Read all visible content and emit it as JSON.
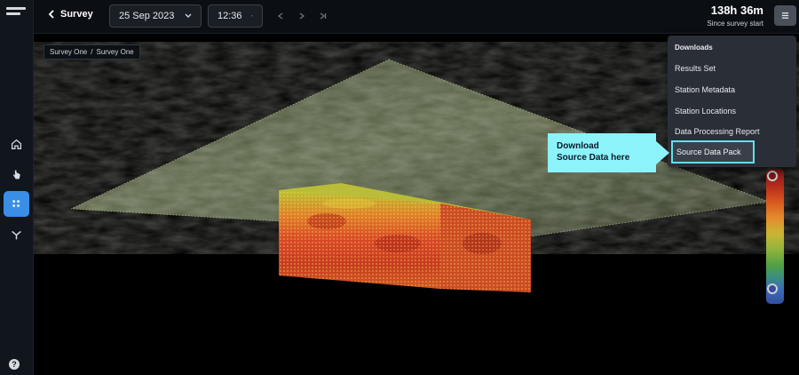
{
  "header": {
    "back_label": "Survey",
    "date_value": "25 Sep 2023",
    "time_value": "12:36",
    "elapsed_value": "138h 36m",
    "elapsed_caption": "Since survey start"
  },
  "breadcrumb": {
    "items": [
      "Survey One",
      "Survey One"
    ],
    "separator": "/"
  },
  "downloads": {
    "header": "Downloads",
    "items": [
      "Results Set",
      "Station Metadata",
      "Station Locations",
      "Data Processing Report",
      "Source Data Pack"
    ],
    "selected_index": 4
  },
  "callout": {
    "line1": "Download",
    "line2": "Source Data here"
  },
  "help": {
    "label": "?"
  },
  "colors": {
    "accent": "#3a8ee6",
    "callout": "#8cf3fb",
    "highlight_border": "#5fe0f0"
  },
  "icons": {
    "logo": "brand-logo-icon",
    "home": "home-icon",
    "hand": "hand-pointer-icon",
    "grid": "grid-icon",
    "antenna": "antenna-icon",
    "menu": "menu-icon",
    "back": "chevron-left-icon"
  }
}
